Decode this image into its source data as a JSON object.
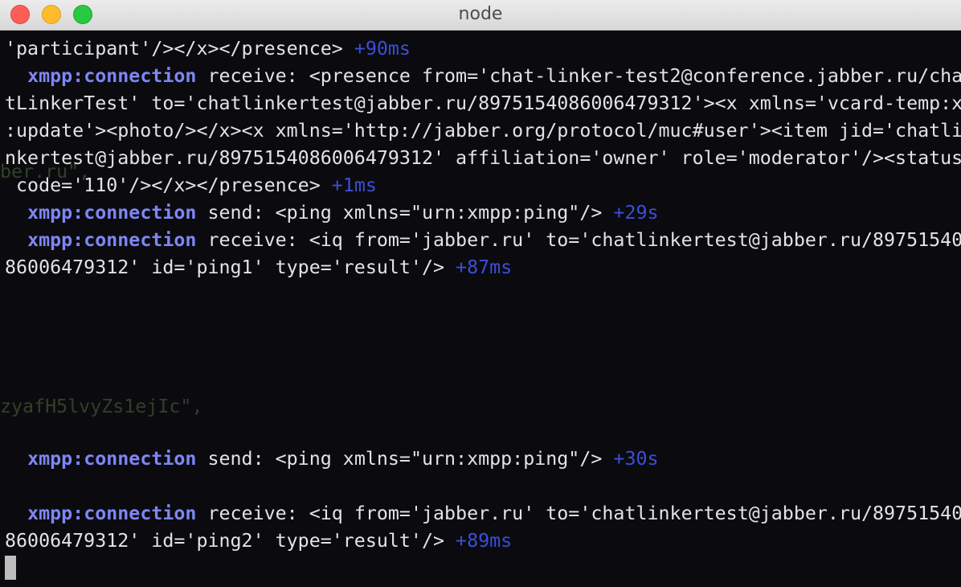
{
  "window": {
    "title": "node"
  },
  "terminal": {
    "ghost": {
      "line1": "ber.ru\",",
      "line2": "zyafH5lvyZs1ejIc\","
    },
    "line1": {
      "text": "'participant'/></x></presence> ",
      "delta": "+90ms"
    },
    "line2": {
      "ns": "xmpp:connection",
      "text": " receive: <presence from='chat-linker-test2@conference.jabber.ru/cha"
    },
    "line3": {
      "text": "tLinkerTest' to='chatlinkertest@jabber.ru/8975154086006479312'><x xmlns='vcard-temp:x"
    },
    "line4": {
      "text": ":update'><photo/></x><x xmlns='http://jabber.org/protocol/muc#user'><item jid='chatli"
    },
    "line5": {
      "text": "nkertest@jabber.ru/8975154086006479312' affiliation='owner' role='moderator'/><status"
    },
    "line6": {
      "text": " code='110'/></x></presence> ",
      "delta": "+1ms"
    },
    "line7": {
      "ns": "xmpp:connection",
      "text": " send: <ping xmlns=\"urn:xmpp:ping\"/> ",
      "delta": "+29s"
    },
    "line8": {
      "ns": "xmpp:connection",
      "text": " receive: <iq from='jabber.ru' to='chatlinkertest@jabber.ru/89751540"
    },
    "line9": {
      "text": "86006479312' id='ping1' type='result'/> ",
      "delta": "+87ms"
    },
    "line10": {
      "ns": "xmpp:connection",
      "text": " send: <ping xmlns=\"urn:xmpp:ping\"/> ",
      "delta": "+30s"
    },
    "line11": {
      "ns": "xmpp:connection",
      "text": " receive: <iq from='jabber.ru' to='chatlinkertest@jabber.ru/89751540"
    },
    "line12": {
      "text": "86006479312' id='ping2' type='result'/> ",
      "delta": "+89ms"
    }
  },
  "colors": {
    "namespace": "#7e86f5",
    "delta": "#3b4ed8",
    "text": "#e3e3e3",
    "background": "#0b0b0f"
  }
}
